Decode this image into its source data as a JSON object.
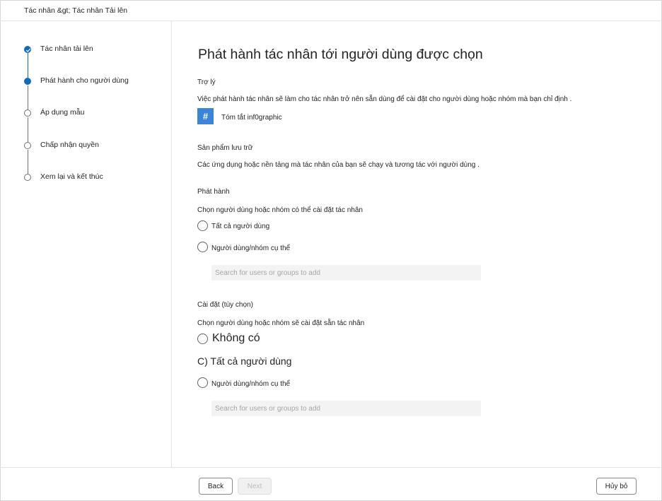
{
  "breadcrumb": "Tác nhân &gt; Tác nhân Tải lên",
  "steps": [
    {
      "label": "Tác nhân tải lên",
      "state": "done"
    },
    {
      "label": "Phát hành cho người dùng",
      "state": "current"
    },
    {
      "label": "Áp dụng mẫu",
      "state": "todo"
    },
    {
      "label": "Chấp nhận quyền",
      "state": "todo"
    },
    {
      "label": "Xem lại và kết thúc",
      "state": "todo"
    }
  ],
  "page_title": "Phát hành tác nhân tới người dùng được chọn",
  "assistant": {
    "heading": "Trợ lý",
    "description": "Việc phát hành tác nhân sẽ làm cho tác nhân trở nên sẵn dùng để cài đặt cho người dùng hoặc nhóm mà bạn chỉ định .",
    "tag_icon": "#",
    "tag_label": "Tóm tắt inf0graphic"
  },
  "storage": {
    "heading": "Sản phẩm lưu trữ",
    "description": "Các ứng dụng hoặc nền tảng mà tác nhân của bạn sẽ chạy và tương tác với người dùng ."
  },
  "publish": {
    "heading": "Phát hành",
    "description": "Chọn người dùng hoặc nhóm có thể cài đặt tác nhân",
    "option_all": "Tất cả người dùng",
    "option_specific": "Người dùng/nhóm cụ thể",
    "search_placeholder": "Search for users or groups to add"
  },
  "install": {
    "heading": "Cài đặt (tùy chọn)",
    "description": "Chọn người dùng hoặc nhóm sẽ cài đặt sẵn tác nhân",
    "option_none": "Không có",
    "option_all": "C) Tất cả người dùng",
    "option_specific": "Người dùng/nhóm cụ thể",
    "search_placeholder": "Search for users or groups to add"
  },
  "footer": {
    "back": "Back",
    "next": "Next",
    "cancel": "Hủy bỏ"
  },
  "colors": {
    "accent": "#0f6cbd",
    "tag": "#3a84d9"
  }
}
